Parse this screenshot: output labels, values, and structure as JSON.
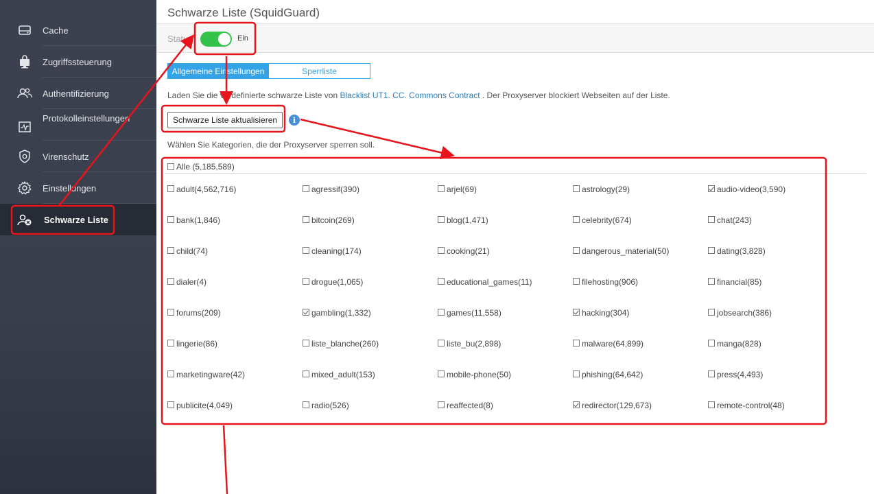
{
  "sidebar": {
    "items": [
      {
        "label": "Cache",
        "icon": "hard-drive-icon"
      },
      {
        "label": "Zugriffssteuerung",
        "icon": "monitor-lock-icon"
      },
      {
        "label": "Authentifizierung",
        "icon": "users-icon"
      },
      {
        "label": "Protokolleinstellungen",
        "icon": "activity-log-icon"
      },
      {
        "label": "Virenschutz",
        "icon": "shield-icon"
      },
      {
        "label": "Einstellungen",
        "icon": "gear-icon"
      },
      {
        "label": "Schwarze Liste",
        "icon": "user-block-icon",
        "active": true
      }
    ]
  },
  "header": {
    "title": "Schwarze Liste (SquidGuard)"
  },
  "status": {
    "label": "Status",
    "toggle_on": true,
    "toggle_text": "Ein",
    "toggle_color": "#35c24a"
  },
  "tabs": [
    {
      "label": "Allgemeine Einstellungen",
      "active": true
    },
    {
      "label": "Sperrliste",
      "active": false
    }
  ],
  "description": {
    "prefix": "Laden Sie die vordefinierte schwarze Liste von ",
    "link": "Blacklist UT1. CC. Commons Contract",
    "suffix": " . Der Proxyserver blockiert Webseiten auf der Liste."
  },
  "update_button": "Schwarze Liste aktualisieren",
  "hint": "Wählen Sie Kategorien, die der Proxyserver sperren soll.",
  "all": {
    "label": "Alle (5,185,589)",
    "checked": false
  },
  "categories": [
    {
      "label": "adult(4,562,716)",
      "checked": false
    },
    {
      "label": "agressif(390)",
      "checked": false
    },
    {
      "label": "arjel(69)",
      "checked": false
    },
    {
      "label": "astrology(29)",
      "checked": false
    },
    {
      "label": "audio-video(3,590)",
      "checked": true
    },
    {
      "label": "bank(1,846)",
      "checked": false
    },
    {
      "label": "bitcoin(269)",
      "checked": false
    },
    {
      "label": "blog(1,471)",
      "checked": false
    },
    {
      "label": "celebrity(674)",
      "checked": false
    },
    {
      "label": "chat(243)",
      "checked": false
    },
    {
      "label": "child(74)",
      "checked": false
    },
    {
      "label": "cleaning(174)",
      "checked": false
    },
    {
      "label": "cooking(21)",
      "checked": false
    },
    {
      "label": "dangerous_material(50)",
      "checked": false
    },
    {
      "label": "dating(3,828)",
      "checked": false
    },
    {
      "label": "dialer(4)",
      "checked": false
    },
    {
      "label": "drogue(1,065)",
      "checked": false
    },
    {
      "label": "educational_games(11)",
      "checked": false
    },
    {
      "label": "filehosting(906)",
      "checked": false
    },
    {
      "label": "financial(85)",
      "checked": false
    },
    {
      "label": "forums(209)",
      "checked": false
    },
    {
      "label": "gambling(1,332)",
      "checked": true
    },
    {
      "label": "games(11,558)",
      "checked": false
    },
    {
      "label": "hacking(304)",
      "checked": true
    },
    {
      "label": "jobsearch(386)",
      "checked": false
    },
    {
      "label": "lingerie(86)",
      "checked": false
    },
    {
      "label": "liste_blanche(260)",
      "checked": false
    },
    {
      "label": "liste_bu(2,898)",
      "checked": false
    },
    {
      "label": "malware(64,899)",
      "checked": false
    },
    {
      "label": "manga(828)",
      "checked": false
    },
    {
      "label": "marketingware(42)",
      "checked": false
    },
    {
      "label": "mixed_adult(153)",
      "checked": false
    },
    {
      "label": "mobile-phone(50)",
      "checked": false
    },
    {
      "label": "phishing(64,642)",
      "checked": false
    },
    {
      "label": "press(4,493)",
      "checked": false
    },
    {
      "label": "publicite(4,049)",
      "checked": false
    },
    {
      "label": "radio(526)",
      "checked": false
    },
    {
      "label": "reaffected(8)",
      "checked": false
    },
    {
      "label": "redirector(129,673)",
      "checked": true
    },
    {
      "label": "remote-control(48)",
      "checked": false
    }
  ],
  "annotation_color": "#e8141b"
}
